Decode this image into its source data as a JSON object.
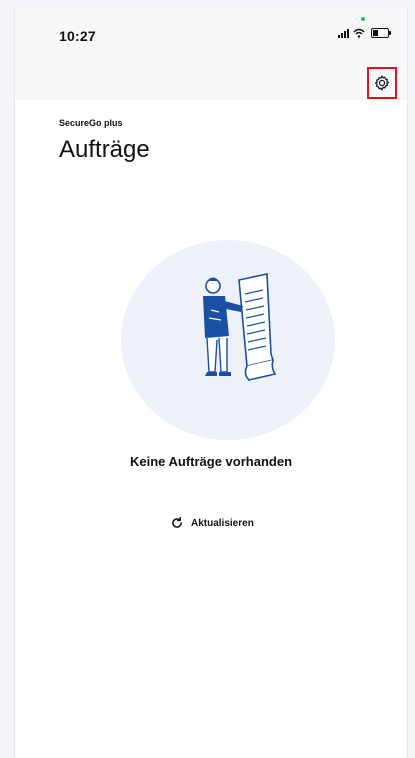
{
  "status_bar": {
    "time": "10:27"
  },
  "header": {
    "app_name": "SecureGo plus",
    "title": "Aufträge",
    "settings_icon": "gear-icon"
  },
  "empty_state": {
    "illustration": "person-with-document-illustration",
    "message": "Keine Aufträge vorhanden"
  },
  "actions": {
    "refresh_label": "Aktualisieren",
    "refresh_icon": "refresh-icon"
  },
  "colors": {
    "highlight": "#e0121f",
    "illustration_bg": "#eef2f8",
    "illustration_accent": "#1b4fa3"
  }
}
